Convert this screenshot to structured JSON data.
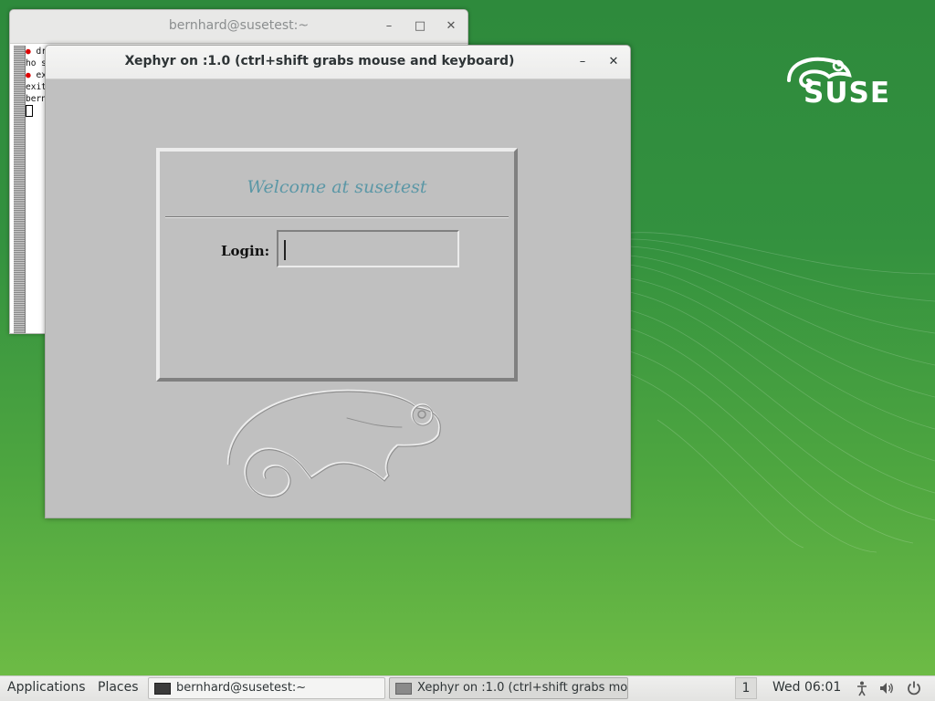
{
  "colors": {
    "desktop_green": "#2e8a3c",
    "welcome_text": "#5b97a6",
    "xephyr_bg": "#c0c0c0"
  },
  "desktop": {
    "brand": "SUSE"
  },
  "terminal": {
    "title": "bernhard@susetest:~",
    "lines": [
      {
        "bullet": "●",
        "text": "dr"
      },
      {
        "bullet": "",
        "text": "ho s"
      },
      {
        "bullet": "●",
        "text": "ex"
      },
      {
        "bullet": "",
        "text": "exit"
      },
      {
        "bullet": "",
        "text": "bern"
      }
    ],
    "buttons": {
      "minimize": "–",
      "maximize": "□",
      "close": "✕"
    }
  },
  "xephyr": {
    "title": "Xephyr on :1.0 (ctrl+shift grabs mouse and keyboard)",
    "buttons": {
      "minimize": "–",
      "close": "✕"
    },
    "login_panel": {
      "welcome": "Welcome at susetest",
      "login_label": "Login:",
      "login_value": ""
    }
  },
  "taskbar": {
    "applications": "Applications",
    "places": "Places",
    "tasks": [
      {
        "label": "bernhard@susetest:~",
        "active": false,
        "icon": "terminal-icon"
      },
      {
        "label": "Xephyr on :1.0 (ctrl+shift grabs mo...",
        "active": true,
        "icon": "window-icon"
      }
    ],
    "workspace": "1",
    "clock": "Wed 06:01",
    "system_icons": [
      "accessibility-icon",
      "volume-icon",
      "power-icon"
    ]
  }
}
